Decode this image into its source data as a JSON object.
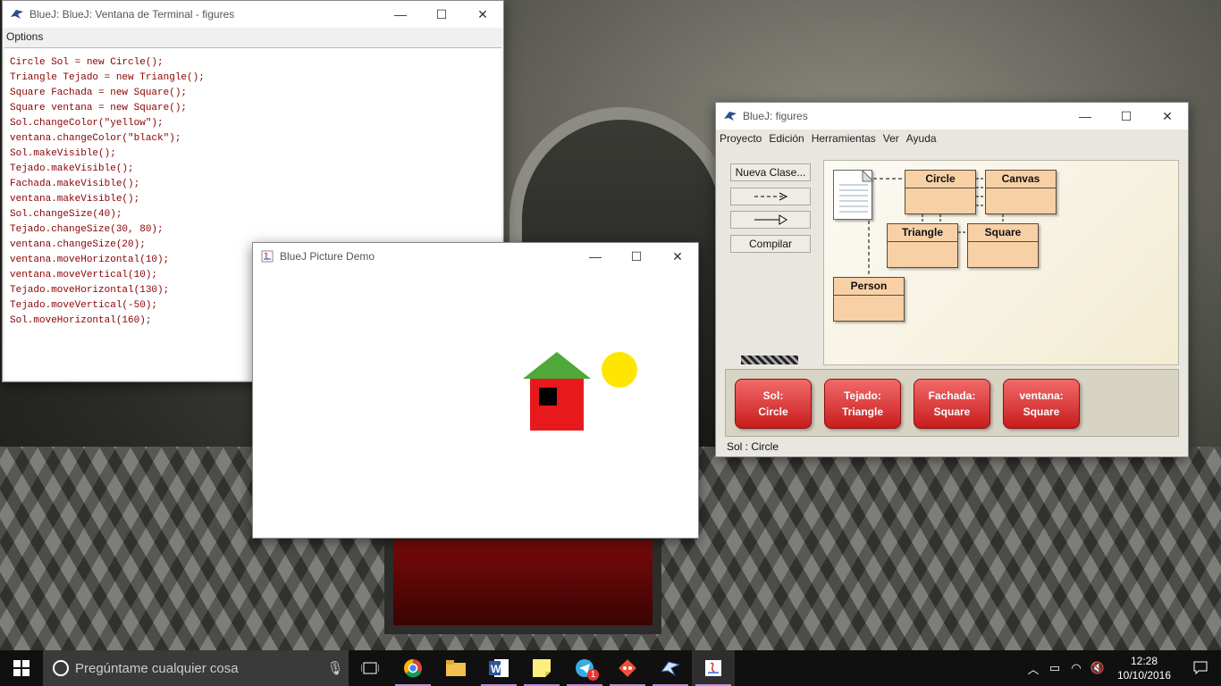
{
  "terminal": {
    "title": "BlueJ: BlueJ:  Ventana de Terminal - figures",
    "menu": [
      "Options"
    ],
    "lines": [
      "Circle Sol = new Circle();",
      "Triangle Tejado = new Triangle();",
      "Square Fachada = new Square();",
      "Square ventana = new Square();",
      "Sol.changeColor(\"yellow\");",
      "ventana.changeColor(\"black\");",
      "Sol.makeVisible();",
      "Tejado.makeVisible();",
      "Fachada.makeVisible();",
      "ventana.makeVisible();",
      "Sol.changeSize(40);",
      "Tejado.changeSize(30, 80);",
      "ventana.changeSize(20);",
      "ventana.moveHorizontal(10);",
      "ventana.moveVertical(10);",
      "Tejado.moveHorizontal(130);",
      "Tejado.moveVertical(-50);",
      "Sol.moveHorizontal(160);"
    ]
  },
  "bluej": {
    "title": "BlueJ:  figures",
    "menu": [
      "Proyecto",
      "Edición",
      "Herramientas",
      "Ver",
      "Ayuda"
    ],
    "new_class_label": "Nueva Clase...",
    "compile_label": "Compilar",
    "classes": [
      "Circle",
      "Canvas",
      "Triangle",
      "Square",
      "Person"
    ],
    "objects": [
      {
        "name": "Sol:",
        "type": "Circle"
      },
      {
        "name": "Tejado:",
        "type": "Triangle"
      },
      {
        "name": "Fachada:",
        "type": "Square"
      },
      {
        "name": "ventana:",
        "type": "Square"
      }
    ],
    "status": "Sol : Circle"
  },
  "demo": {
    "title": "BlueJ Picture Demo",
    "colors": {
      "sun": "#ffe600",
      "roof": "#4ea83a",
      "wall": "#e8191c",
      "window": "#000000"
    }
  },
  "taskbar": {
    "search_placeholder": "Pregúntame cualquier cosa",
    "apps": [
      "task-view-icon",
      "chrome-icon",
      "file-explorer-icon",
      "word-icon",
      "sticky-notes-icon",
      "telegram-icon",
      "git-icon",
      "bluej-icon",
      "java-icon"
    ],
    "telegram_badge": "1",
    "time": "12:28",
    "date": "10/10/2016"
  }
}
